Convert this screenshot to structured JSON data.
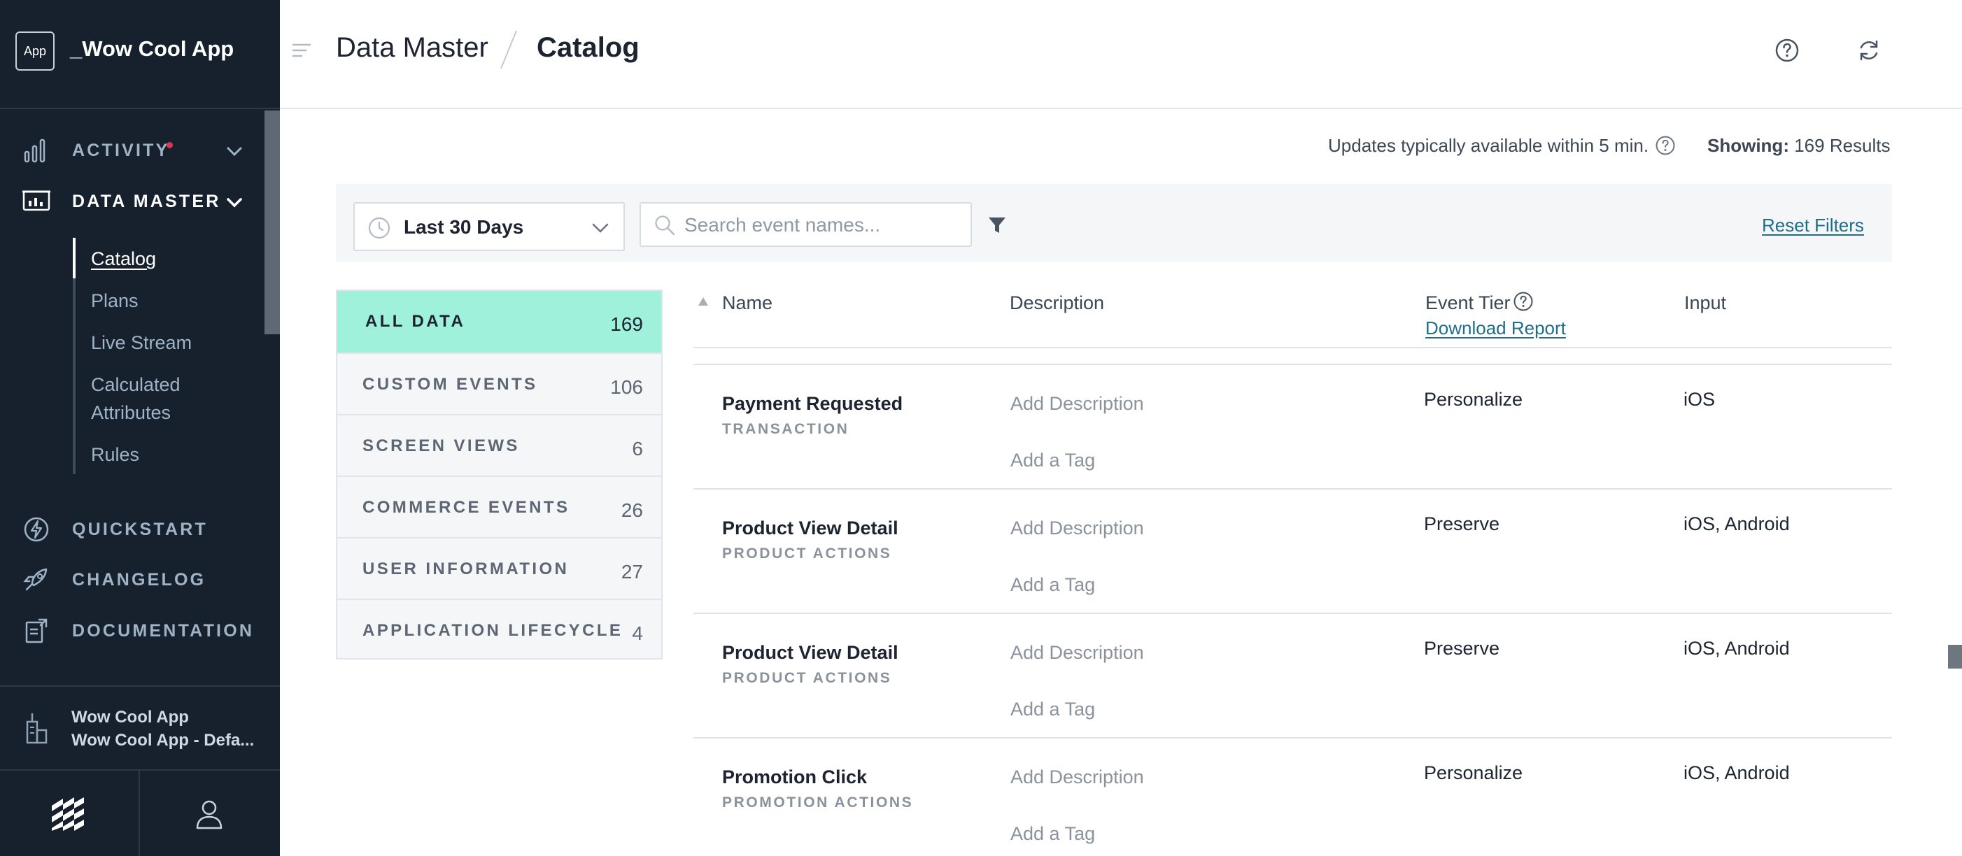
{
  "app": {
    "logo_text": "App",
    "name": "_Wow Cool App"
  },
  "sidebar": {
    "nav": [
      {
        "label": "ACTIVITY",
        "icon": "bar-chart-icon",
        "has_alert": true
      },
      {
        "label": "DATA MASTER",
        "icon": "data-screen-icon",
        "expanded": true
      },
      {
        "label": "QUICKSTART",
        "icon": "lightning-icon"
      },
      {
        "label": "CHANGELOG",
        "icon": "rocket-icon"
      },
      {
        "label": "DOCUMENTATION",
        "icon": "document-icon"
      }
    ],
    "sub_items": [
      "Catalog",
      "Plans",
      "Live Stream",
      "Calculated Attributes",
      "Rules"
    ],
    "active_sub": "Catalog",
    "workspace": {
      "name": "Wow Cool App",
      "sub": "Wow Cool App - Defa..."
    }
  },
  "header": {
    "breadcrumb": [
      "Data Master",
      "Catalog"
    ]
  },
  "status": {
    "update_note": "Updates typically available within 5 min.",
    "showing_label": "Showing:",
    "showing_value": "169 Results"
  },
  "filters": {
    "date_range": "Last 30 Days",
    "search_placeholder": "Search event names...",
    "search_value": "",
    "reset_label": "Reset Filters"
  },
  "categories": [
    {
      "label": "ALL DATA",
      "count": "169",
      "active": true
    },
    {
      "label": "CUSTOM EVENTS",
      "count": "106"
    },
    {
      "label": "SCREEN VIEWS",
      "count": "6"
    },
    {
      "label": "COMMERCE EVENTS",
      "count": "26"
    },
    {
      "label": "USER INFORMATION",
      "count": "27"
    },
    {
      "label": "APPLICATION LIFECYCLE",
      "count": "4"
    }
  ],
  "table": {
    "columns": {
      "name": "Name",
      "description": "Description",
      "tier": "Event Tier",
      "input": "Input"
    },
    "download_report": "Download Report",
    "rows": [
      {
        "name": "Payment Requested",
        "category": "TRANSACTION",
        "description": "Add Description",
        "tag": "Add a Tag",
        "tier": "Personalize",
        "input": "iOS"
      },
      {
        "name": "Product View Detail",
        "category": "PRODUCT ACTIONS",
        "description": "Add Description",
        "tag": "Add a Tag",
        "tier": "Preserve",
        "input": "iOS, Android"
      },
      {
        "name": "Product View Detail",
        "category": "PRODUCT ACTIONS",
        "description": "Add Description",
        "tag": "Add a Tag",
        "tier": "Preserve",
        "input": "iOS, Android"
      },
      {
        "name": "Promotion Click",
        "category": "PROMOTION ACTIONS",
        "description": "Add Description",
        "tag": "Add a Tag",
        "tier": "Personalize",
        "input": "iOS, Android"
      }
    ]
  },
  "colors": {
    "sidebar_bg": "#17212d",
    "accent_active": "#9ff1dc",
    "link": "#1f6e8a",
    "alert_dot": "#e0344e"
  }
}
